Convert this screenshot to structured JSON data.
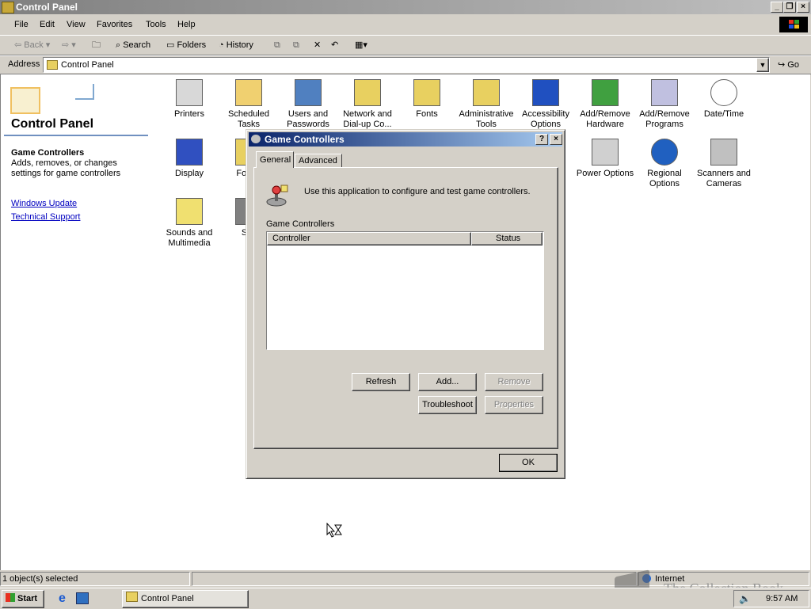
{
  "window": {
    "title": "Control Panel",
    "menu": [
      "File",
      "Edit",
      "View",
      "Favorites",
      "Tools",
      "Help"
    ],
    "toolbar": {
      "back": "Back",
      "search": "Search",
      "folders": "Folders",
      "history": "History"
    },
    "address_label": "Address",
    "address_value": "Control Panel",
    "go_label": "Go"
  },
  "left_panel": {
    "title": "Control Panel",
    "selected_name": "Game Controllers",
    "selected_desc": "Adds, removes, or changes settings for game controllers",
    "links": [
      "Windows Update",
      "Technical Support"
    ]
  },
  "icons": [
    {
      "label": "Printers",
      "icon": "printer-icon"
    },
    {
      "label": "Scheduled Tasks",
      "icon": "scheduled-tasks-icon"
    },
    {
      "label": "Users and Passwords",
      "icon": "users-icon"
    },
    {
      "label": "Network and Dial-up Co...",
      "icon": "network-icon"
    },
    {
      "label": "Fonts",
      "icon": "fonts-icon"
    },
    {
      "label": "Administrative Tools",
      "icon": "admin-tools-icon"
    },
    {
      "label": "Accessibility Options",
      "icon": "accessibility-icon"
    },
    {
      "label": "Add/Remove Hardware",
      "icon": "hardware-icon"
    },
    {
      "label": "Add/Remove Programs",
      "icon": "programs-icon"
    },
    {
      "label": "Date/Time",
      "icon": "clock-icon"
    },
    {
      "label": "Display",
      "icon": "display-icon"
    },
    {
      "label": "Folder",
      "icon": "folder-icon"
    },
    {
      "label": "Power Options",
      "icon": "power-icon"
    },
    {
      "label": "Regional Options",
      "icon": "globe-icon"
    },
    {
      "label": "Scanners and Cameras",
      "icon": "scanner-icon"
    },
    {
      "label": "Sounds and Multimedia",
      "icon": "speaker-icon"
    },
    {
      "label": "Sys",
      "icon": "system-icon"
    }
  ],
  "dialog": {
    "title": "Game Controllers",
    "tabs": [
      "General",
      "Advanced"
    ],
    "description": "Use this application to configure and test game controllers.",
    "group_label": "Game Controllers",
    "columns": [
      "Controller",
      "Status"
    ],
    "buttons": {
      "refresh": "Refresh",
      "add": "Add...",
      "remove": "Remove",
      "troubleshoot": "Troubleshoot",
      "properties": "Properties",
      "ok": "OK"
    }
  },
  "statusbar": {
    "left": "1 object(s) selected",
    "zone": "Internet"
  },
  "watermark": "The Collection Book",
  "taskbar": {
    "start": "Start",
    "task": "Control Panel",
    "time": "9:57 AM"
  }
}
